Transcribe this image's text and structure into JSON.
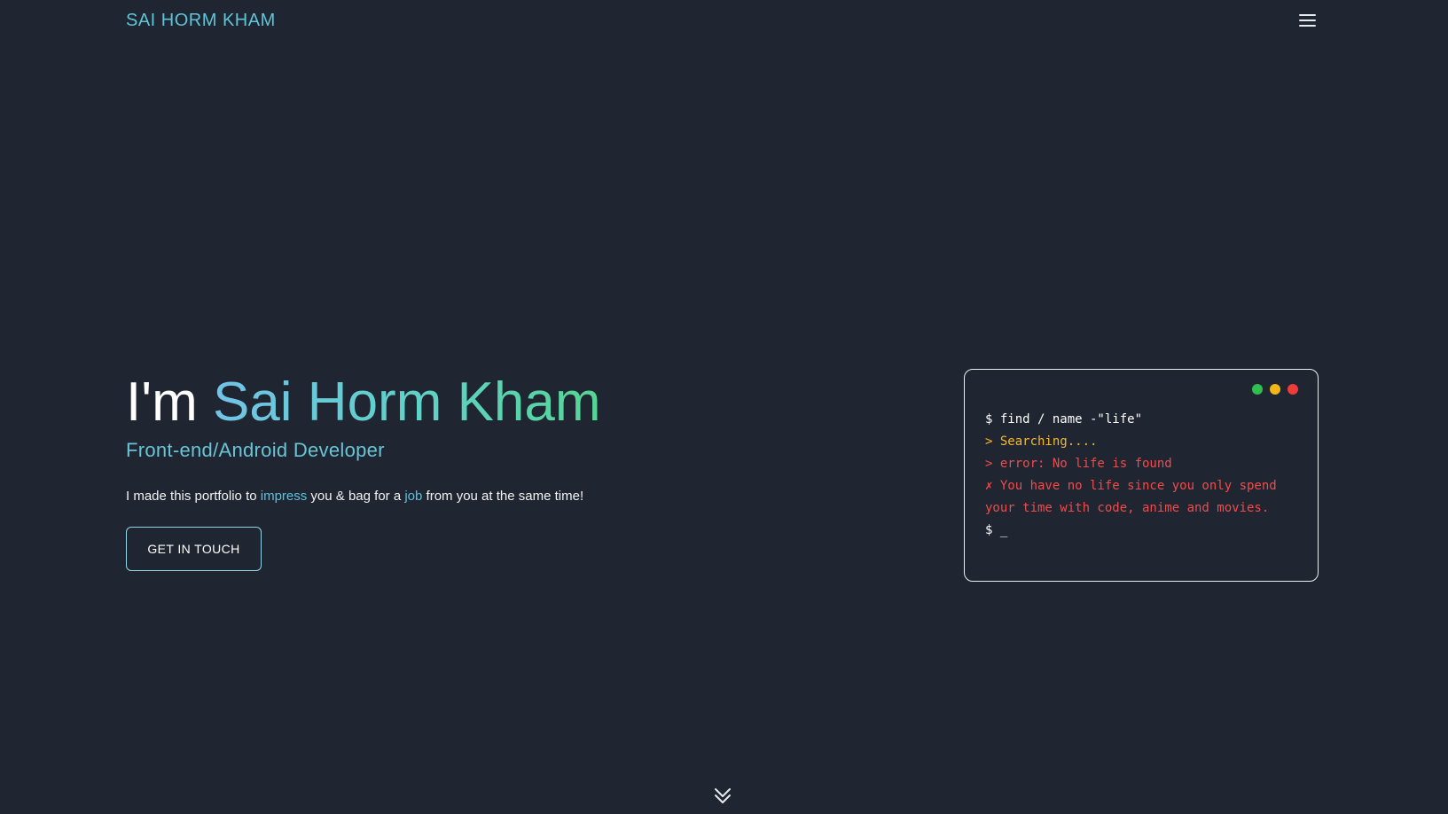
{
  "header": {
    "brand": "SAI HORM KHAM",
    "menu_icon": "hamburger-menu-icon"
  },
  "hero": {
    "greeting": "I'm",
    "name": "Sai Horm Kham",
    "role": "Front-end/Android Developer",
    "tagline": {
      "part1": "I made this portfolio to ",
      "highlight1": "impress",
      "part2": " you & bag for a ",
      "highlight2": "job",
      "part3": " from you at the same time!"
    },
    "cta_label": "GET IN TOUCH"
  },
  "terminal": {
    "dots": [
      {
        "name": "green-dot",
        "color": "#2fbf4f"
      },
      {
        "name": "yellow-dot",
        "color": "#f2b619"
      },
      {
        "name": "red-dot",
        "color": "#ee3b3b"
      }
    ],
    "lines": [
      {
        "text": "$ find / name -\"life\"",
        "color": "#ffffff"
      },
      {
        "text": "> Searching....",
        "color": "#f5b731"
      },
      {
        "text": "> error: No life is found",
        "color": "#ef4b4b"
      },
      {
        "text": "✗ You have no life since you only spend your time with code, anime and movies.",
        "color": "#ef4b4b"
      },
      {
        "text": "$ _",
        "color": "#ffffff"
      }
    ]
  },
  "scroll": {
    "icon": "double-chevron-down-icon"
  },
  "colors": {
    "background": "#202631",
    "accent": "#5ec5d8",
    "name_gradient_start": "#72c3e6",
    "name_gradient_end": "#56d494"
  }
}
